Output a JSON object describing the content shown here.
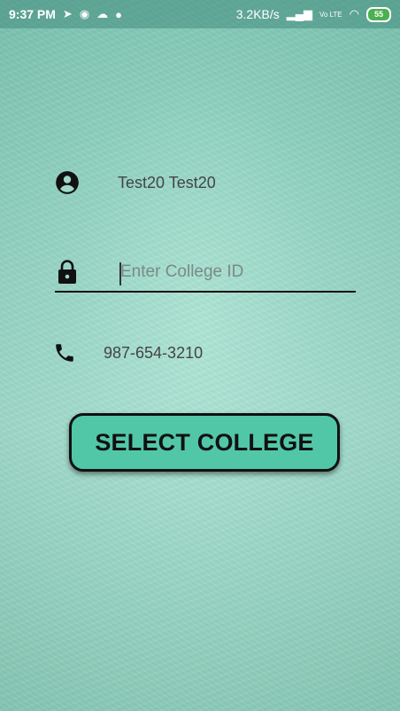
{
  "status_bar": {
    "time": "9:37 PM",
    "speed": "3.2KB/s",
    "network": "Vo LTE",
    "battery": "55"
  },
  "profile": {
    "name": "Test20 Test20",
    "college_id_placeholder": "Enter College ID",
    "college_id_value": "",
    "phone": "987-654-3210"
  },
  "actions": {
    "select_college_label": "SELECT COLLEGE"
  },
  "icons": [
    "account-circle-icon",
    "lock-icon",
    "phone-icon"
  ],
  "colors": {
    "button": "#51c7a8",
    "background": "#9fd8c9"
  }
}
